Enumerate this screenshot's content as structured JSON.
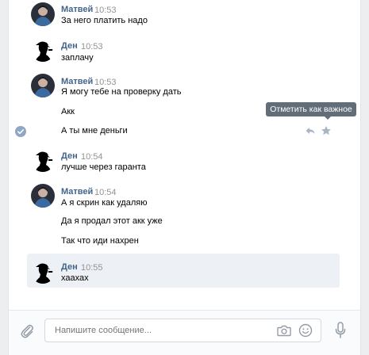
{
  "messages": [
    {
      "author": "Матвей",
      "time": "10:53",
      "lines": [
        "За него платить надо"
      ]
    },
    {
      "author": "Ден",
      "time": "10:53",
      "lines": [
        "заплачу"
      ]
    },
    {
      "author": "Матвей",
      "time": "10:53",
      "lines": [
        "Я могу тебе на проверку дать",
        "Акк",
        "А ты мне деньги"
      ]
    },
    {
      "author": "Ден",
      "time": "10:54",
      "lines": [
        "лучше через гаранта"
      ]
    },
    {
      "author": "Матвей",
      "time": "10:54",
      "lines": [
        "А я скрин как удаляю",
        "Да я продал этот акк уже",
        "Так что иди нахрен"
      ]
    },
    {
      "author": "Ден",
      "time": "10:55",
      "lines": [
        "хаахах"
      ]
    }
  ],
  "tooltip": {
    "text": "Отметить как важное"
  },
  "composer": {
    "placeholder": "Напишите сообщение..."
  },
  "colors": {
    "author": "#42648b",
    "time": "#939393",
    "accent": "#5181b8",
    "selected_bg": "#edf0f5",
    "tooltip_bg": "#626d7a"
  }
}
